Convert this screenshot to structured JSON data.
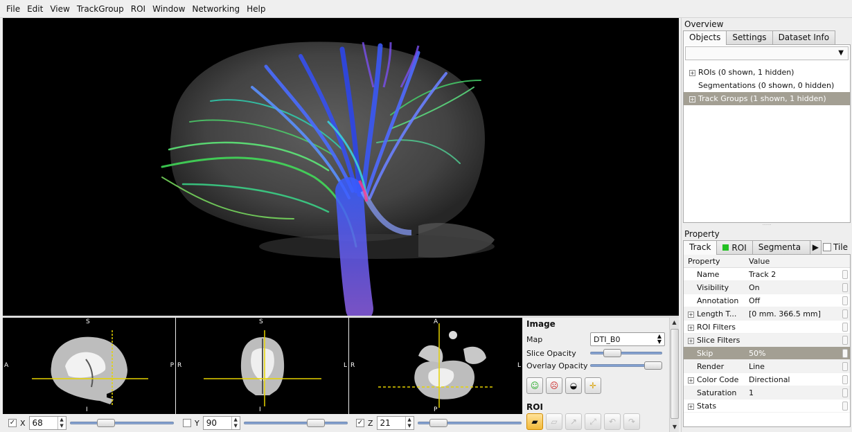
{
  "menu": [
    "File",
    "Edit",
    "View",
    "TrackGroup",
    "ROI",
    "Window",
    "Networking",
    "Help"
  ],
  "slices": {
    "sagittal": {
      "top": "S",
      "bottom": "I",
      "left": "A",
      "right": "P"
    },
    "coronal": {
      "top": "S",
      "bottom": "I",
      "left": "R",
      "right": "L"
    },
    "axial": {
      "top": "A",
      "bottom": "P",
      "left": "R",
      "right": "L"
    }
  },
  "sliders": [
    {
      "axis": "X",
      "checked": true,
      "check_glyph": "✓",
      "value": "68",
      "level": 0.35
    },
    {
      "axis": "Y",
      "checked": false,
      "check_glyph": "",
      "value": "90",
      "level": 0.7
    },
    {
      "axis": "Z",
      "checked": true,
      "check_glyph": "✓",
      "value": "21",
      "level": 0.2
    }
  ],
  "image_panel": {
    "title": "Image",
    "map_label": "Map",
    "map_value": "DTI_B0",
    "slice_opacity_label": "Slice Opacity",
    "slice_opacity_level": 0.3,
    "overlay_opacity_label": "Overlay Opacity",
    "overlay_opacity_level": 0.95,
    "roi_title": "ROI"
  },
  "overview": {
    "title": "Overview",
    "tabs": [
      "Objects",
      "Settings",
      "Dataset Info"
    ],
    "active_tab": "Objects",
    "items": [
      {
        "label": "ROIs (0 shown, 1 hidden)",
        "expander": "+",
        "selected": false
      },
      {
        "label": "Segmentations (0 shown, 0 hidden)",
        "expander": "",
        "selected": false
      },
      {
        "label": "Track Groups (1 shown, 1 hidden)",
        "expander": "+",
        "selected": true
      }
    ]
  },
  "property": {
    "title": "Property",
    "tabs": [
      "Track",
      "ROI",
      "Segmenta"
    ],
    "tile_label": "Tile",
    "headers": [
      "Property",
      "Value"
    ],
    "rows": [
      {
        "key": "Name",
        "value": "Track 2",
        "expander": ""
      },
      {
        "key": "Visibility",
        "value": "On",
        "expander": ""
      },
      {
        "key": "Annotation",
        "value": "Off",
        "expander": ""
      },
      {
        "key": "Length T...",
        "value": "[0 mm.  366.5 mm]",
        "expander": "+"
      },
      {
        "key": "ROI Filters",
        "value": "",
        "expander": "+"
      },
      {
        "key": "Slice Filters",
        "value": "",
        "expander": "+"
      },
      {
        "key": "Skip",
        "value": "50%",
        "expander": "",
        "selected": true
      },
      {
        "key": "Render",
        "value": "Line",
        "expander": ""
      },
      {
        "key": "Color Code",
        "value": "Directional",
        "expander": "+"
      },
      {
        "key": "Saturation",
        "value": "1",
        "expander": ""
      },
      {
        "key": "Stats",
        "value": "",
        "expander": "+"
      }
    ]
  },
  "colors": {
    "selection": "#a39f93",
    "crosshair": "#e6d300",
    "roi_green": "#22c022"
  }
}
